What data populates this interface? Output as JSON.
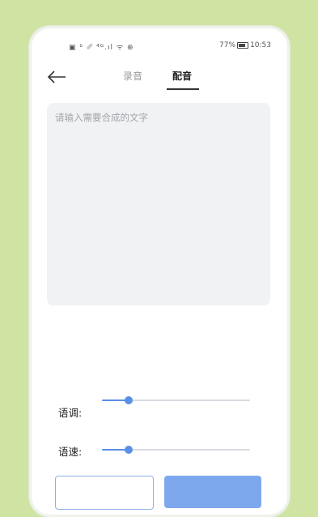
{
  "status_bar": {
    "left_icons": "▣ ᵇ ␥ ⁴ᴳ.ıl ᯤ ⊕",
    "battery_percent": "77%",
    "time": "10:53"
  },
  "tabs": [
    {
      "label": "录音",
      "active": false
    },
    {
      "label": "配音",
      "active": true
    }
  ],
  "input": {
    "placeholder": "请输入需要合成的文字",
    "value": ""
  },
  "params": {
    "tone_label": "语调:",
    "tone_level": 0.18,
    "speed_label": "语速:",
    "speed_level": 0.18
  },
  "colors": {
    "background": "#cfe4a3",
    "accent": "#5a8fe6",
    "button_fill": "#7ea8ee"
  },
  "icons": {
    "back": "arrow-left-icon",
    "battery": "battery-icon"
  }
}
